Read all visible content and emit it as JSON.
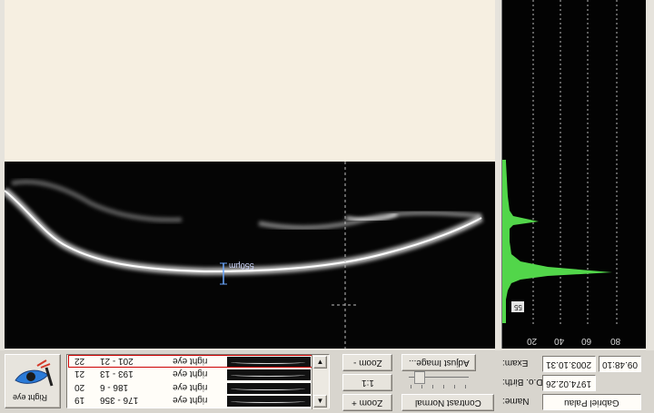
{
  "scan": {
    "thickness_label": "550µm"
  },
  "histogram": {
    "x_ticks": [
      "20",
      "40",
      "60",
      "80"
    ],
    "level_tag": "55"
  },
  "eye_selector": {
    "label": "Right eye"
  },
  "scan_list": {
    "rows": [
      {
        "number": "22",
        "range": "201 - 21",
        "eye": "right eye"
      },
      {
        "number": "21",
        "range": "193 - 13",
        "eye": "right eye"
      },
      {
        "number": "20",
        "range": "186 - 6",
        "eye": "right eye"
      },
      {
        "number": "19",
        "range": "176 - 356",
        "eye": "right eye"
      }
    ],
    "selected_row": "22",
    "scroll_up_glyph": "▲",
    "scroll_down_glyph": "▼"
  },
  "controls": {
    "zoom_minus": "Zoom -",
    "zoom_reset": "1:1",
    "zoom_plus": "Zoom +",
    "adjust_image": "Adjust Image...",
    "contrast_normal": "Contrast Normal"
  },
  "patient": {
    "exam_label": "Exam:",
    "exam_date": "2003.10.31",
    "exam_time": "09.48:10",
    "dob_label": "D.o. Birth:",
    "dob": "1974.02.26",
    "name_label": "Name:",
    "name": "Gabriel Palau"
  },
  "colors": {
    "histogram_fill": "#52d64a",
    "selected_row_border": "#cc0000"
  }
}
